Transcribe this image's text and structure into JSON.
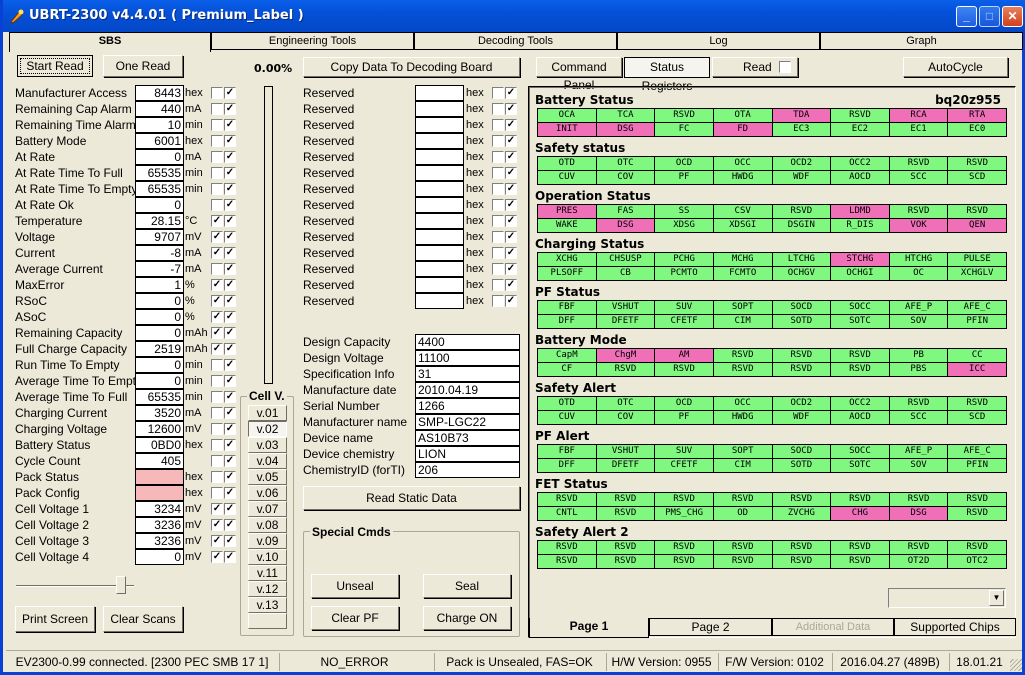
{
  "window": {
    "title": "UBRT-2300 v4.4.01  ( Premium_Label )",
    "minimize": "_",
    "maximize": "□",
    "close": "✕"
  },
  "main_tabs": [
    "SBS",
    "Engineering Tools",
    "Decoding Tools",
    "Log",
    "Graph"
  ],
  "buttons": {
    "start_read": "Start Read",
    "one_read": "One Read",
    "copy_data": "Copy Data To Decoding Board",
    "print_screen": "Print Screen",
    "clear_scans": "Clear Scans",
    "read_static": "Read Static Data",
    "unseal": "Unseal",
    "seal": "Seal",
    "clear_pf": "Clear PF",
    "charge_on": "Charge ON",
    "command_panel": "Command Panel",
    "status_registers": "Status Registers",
    "read": "Read",
    "autocycle": "AutoCycle"
  },
  "progress_percent": "0.00%",
  "sbs_fields": [
    {
      "label": "Manufacturer Access",
      "value": "8443",
      "unit": "hex",
      "cb1": false,
      "cb2": true
    },
    {
      "label": "Remaining Cap Alarm",
      "value": "440",
      "unit": "mA",
      "cb1": false,
      "cb2": true
    },
    {
      "label": "Remaining Time Alarm",
      "value": "10",
      "unit": "min",
      "cb1": false,
      "cb2": true
    },
    {
      "label": "Battery Mode",
      "value": "6001",
      "unit": "hex",
      "cb1": false,
      "cb2": true
    },
    {
      "label": "At Rate",
      "value": "0",
      "unit": "mA",
      "cb1": false,
      "cb2": true
    },
    {
      "label": "At Rate Time To Full",
      "value": "65535",
      "unit": "min",
      "cb1": false,
      "cb2": true
    },
    {
      "label": "At Rate Time To Empty",
      "value": "65535",
      "unit": "min",
      "cb1": false,
      "cb2": true
    },
    {
      "label": "At Rate Ok",
      "value": "0",
      "unit": "",
      "cb1": false,
      "cb2": true
    },
    {
      "label": "Temperature",
      "value": "28.15",
      "unit": "°C",
      "cb1": true,
      "cb2": true
    },
    {
      "label": "Voltage",
      "value": "9707",
      "unit": "mV",
      "cb1": true,
      "cb2": true
    },
    {
      "label": "Current",
      "value": "-8",
      "unit": "mA",
      "cb1": true,
      "cb2": true
    },
    {
      "label": "Average Current",
      "value": "-7",
      "unit": "mA",
      "cb1": false,
      "cb2": true
    },
    {
      "label": "MaxError",
      "value": "1",
      "unit": "%",
      "cb1": true,
      "cb2": true
    },
    {
      "label": "RSoC",
      "value": "0",
      "unit": "%",
      "cb1": true,
      "cb2": true
    },
    {
      "label": "ASoC",
      "value": "0",
      "unit": "%",
      "cb1": true,
      "cb2": true
    },
    {
      "label": "Remaining Capacity",
      "value": "0",
      "unit": "mAh",
      "cb1": true,
      "cb2": true
    },
    {
      "label": "Full Charge Capacity",
      "value": "2519",
      "unit": "mAh",
      "cb1": true,
      "cb2": true
    },
    {
      "label": "Run Time To Empty",
      "value": "0",
      "unit": "min",
      "cb1": false,
      "cb2": true
    },
    {
      "label": "Average Time To Empty",
      "value": "0",
      "unit": "min",
      "cb1": false,
      "cb2": true
    },
    {
      "label": "Average Time To Full",
      "value": "65535",
      "unit": "min",
      "cb1": false,
      "cb2": true
    },
    {
      "label": "Charging Current",
      "value": "3520",
      "unit": "mA",
      "cb1": false,
      "cb2": true
    },
    {
      "label": "Charging Voltage",
      "value": "12600",
      "unit": "mV",
      "cb1": false,
      "cb2": true
    },
    {
      "label": "Battery Status",
      "value": "0BD0",
      "unit": "hex",
      "cb1": false,
      "cb2": true
    },
    {
      "label": "Cycle Count",
      "value": "405",
      "unit": "",
      "cb1": false,
      "cb2": true
    },
    {
      "label": "Pack Status",
      "value": "",
      "unit": "hex",
      "cb1": false,
      "cb2": true,
      "pink": true
    },
    {
      "label": "Pack Config",
      "value": "",
      "unit": "hex",
      "cb1": false,
      "cb2": true,
      "pink": true
    },
    {
      "label": "Cell Voltage 1",
      "value": "3234",
      "unit": "mV",
      "cb1": true,
      "cb2": true
    },
    {
      "label": "Cell Voltage 2",
      "value": "3236",
      "unit": "mV",
      "cb1": true,
      "cb2": true
    },
    {
      "label": "Cell Voltage 3",
      "value": "3236",
      "unit": "mV",
      "cb1": true,
      "cb2": true
    },
    {
      "label": "Cell Voltage 4",
      "value": "0",
      "unit": "mV",
      "cb1": true,
      "cb2": true
    }
  ],
  "reserved_fields": {
    "label": "Reserved",
    "unit": "hex",
    "count": 14
  },
  "static_data": [
    {
      "label": "Design Capacity",
      "value": "4400"
    },
    {
      "label": "Design Voltage",
      "value": "11100"
    },
    {
      "label": "Specification Info",
      "value": "31"
    },
    {
      "label": "Manufacture date",
      "value": "2010.04.19"
    },
    {
      "label": "Serial Number",
      "value": "1266"
    },
    {
      "label": "Manufacturer name",
      "value": "SMP-LGC22"
    },
    {
      "label": "Device name",
      "value": "AS10B73"
    },
    {
      "label": "Device chemistry",
      "value": "LION"
    },
    {
      "label": "ChemistryID (forTI)",
      "value": "206"
    }
  ],
  "cell_v": {
    "title": "Cell V.",
    "buttons": [
      "v.01",
      "v.02",
      "v.03",
      "v.04",
      "v.05",
      "v.06",
      "v.07",
      "v.08",
      "v.09",
      "v.10",
      "v.11",
      "v.12",
      "v.13",
      ""
    ],
    "selected": 1
  },
  "special_cmds_title": "Special Cmds",
  "chip": "bq20z955",
  "registers": [
    {
      "title": "Battery Status",
      "row1": [
        "OCA",
        "TCA",
        "RSVD",
        "OTA",
        "TDA",
        "RSVD",
        "RCA",
        "RTA"
      ],
      "on1": [
        4,
        6,
        7
      ],
      "row2": [
        "INIT",
        "DSG",
        "FC",
        "FD",
        "EC3",
        "EC2",
        "EC1",
        "EC0"
      ],
      "on2": [
        0,
        1,
        3
      ]
    },
    {
      "title": "Safety status",
      "row1": [
        "OTD",
        "OTC",
        "OCD",
        "OCC",
        "OCD2",
        "OCC2",
        "RSVD",
        "RSVD"
      ],
      "on1": [],
      "row2": [
        "CUV",
        "COV",
        "PF",
        "HWDG",
        "WDF",
        "AOCD",
        "SCC",
        "SCD"
      ],
      "on2": []
    },
    {
      "title": "Operation Status",
      "row1": [
        "PRES",
        "FAS",
        "SS",
        "CSV",
        "RSVD",
        "LDMD",
        "RSVD",
        "RSVD"
      ],
      "on1": [
        0,
        5
      ],
      "row2": [
        "WAKE",
        "DSG",
        "XDSG",
        "XDSGI",
        "DSGIN",
        "R_DIS",
        "VOK",
        "QEN"
      ],
      "on2": [
        1,
        6,
        7
      ]
    },
    {
      "title": "Charging Status",
      "row1": [
        "XCHG",
        "CHSUSP",
        "PCHG",
        "MCHG",
        "LTCHG",
        "STCHG",
        "HTCHG",
        "PULSE"
      ],
      "on1": [
        5
      ],
      "row2": [
        "PLSOFF",
        "CB",
        "PCMTO",
        "FCMTO",
        "OCHGV",
        "OCHGI",
        "OC",
        "XCHGLV"
      ],
      "on2": []
    },
    {
      "title": "PF Status",
      "row1": [
        "FBF",
        "VSHUT",
        "SUV",
        "SOPT",
        "SOCD",
        "SOCC",
        "AFE_P",
        "AFE_C"
      ],
      "on1": [],
      "row2": [
        "DFF",
        "DFETF",
        "CFETF",
        "CIM",
        "SOTD",
        "SOTC",
        "SOV",
        "PFIN"
      ],
      "on2": []
    },
    {
      "title": "Battery Mode",
      "row1": [
        "CapM",
        "ChgM",
        "AM",
        "RSVD",
        "RSVD",
        "RSVD",
        "PB",
        "CC"
      ],
      "on1": [
        1,
        2
      ],
      "row2": [
        "CF",
        "RSVD",
        "RSVD",
        "RSVD",
        "RSVD",
        "RSVD",
        "PBS",
        "ICC"
      ],
      "on2": [
        7
      ]
    },
    {
      "title": "Safety Alert",
      "row1": [
        "OTD",
        "OTC",
        "OCD",
        "OCC",
        "OCD2",
        "OCC2",
        "RSVD",
        "RSVD"
      ],
      "on1": [],
      "row2": [
        "CUV",
        "COV",
        "PF",
        "HWDG",
        "WDF",
        "AOCD",
        "SCC",
        "SCD"
      ],
      "on2": []
    },
    {
      "title": "PF Alert",
      "row1": [
        "FBF",
        "VSHUT",
        "SUV",
        "SOPT",
        "SOCD",
        "SOCC",
        "AFE_P",
        "AFE_C"
      ],
      "on1": [],
      "row2": [
        "DFF",
        "DFETF",
        "CFETF",
        "CIM",
        "SOTD",
        "SOTC",
        "SOV",
        "PFIN"
      ],
      "on2": []
    },
    {
      "title": "FET Status",
      "row1": [
        "RSVD",
        "RSVD",
        "RSVD",
        "RSVD",
        "RSVD",
        "RSVD",
        "RSVD",
        "RSVD"
      ],
      "on1": [],
      "row2": [
        "CNTL",
        "RSVD",
        "PMS_CHG",
        "OD",
        "ZVCHG",
        "CHG",
        "DSG",
        "RSVD"
      ],
      "on2": [
        5,
        6
      ]
    },
    {
      "title": "Safety Alert 2",
      "row1": [
        "RSVD",
        "RSVD",
        "RSVD",
        "RSVD",
        "RSVD",
        "RSVD",
        "RSVD",
        "RSVD"
      ],
      "on1": [],
      "row2": [
        "RSVD",
        "RSVD",
        "RSVD",
        "RSVD",
        "RSVD",
        "RSVD",
        "OT2D",
        "OTC2"
      ],
      "on2": []
    }
  ],
  "page_tabs": [
    "Page 1",
    "Page 2",
    "Additional Data",
    "Supported Chips"
  ],
  "status_bar": [
    "EV2300-0.99 connected. [2300  PEC  SMB  17 1]",
    "NO_ERROR",
    "Pack is Unsealed, FAS=OK",
    "H/W Version: 0955",
    "F/W Version: 0102",
    "2016.04.27  (489B)",
    "18.01.21"
  ],
  "colors": {
    "bit_off": "#80f880",
    "bit_on": "#f070b8",
    "title_bar": "#0451d8"
  }
}
